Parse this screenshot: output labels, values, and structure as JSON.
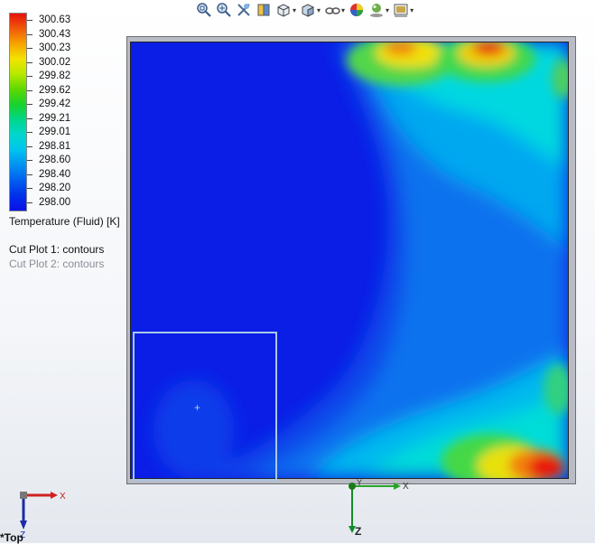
{
  "toolbar": {
    "items": [
      {
        "icon": "zoom-to-fit-icon",
        "caret": false
      },
      {
        "icon": "zoom-to-area-icon",
        "caret": false
      },
      {
        "icon": "previous-view-icon",
        "caret": false
      },
      {
        "icon": "section-view-icon",
        "caret": false
      },
      {
        "icon": "view-orientation-icon",
        "caret": true
      },
      {
        "icon": "display-style-icon",
        "caret": true
      },
      {
        "icon": "hide-show-items-icon",
        "caret": true
      },
      {
        "icon": "edit-appearance-icon",
        "caret": false
      },
      {
        "icon": "apply-scene-icon",
        "caret": true
      },
      {
        "icon": "view-settings-icon",
        "caret": true
      }
    ]
  },
  "legend": {
    "labels": [
      "300.63",
      "300.43",
      "300.23",
      "300.02",
      "299.82",
      "299.62",
      "299.42",
      "299.21",
      "299.01",
      "298.81",
      "298.60",
      "298.40",
      "298.20",
      "298.00"
    ],
    "colors": [
      "#e8100c",
      "#f05a08",
      "#f7a400",
      "#f2e400",
      "#b6e800",
      "#5cd800",
      "#18d22c",
      "#00d68a",
      "#00d6cc",
      "#00c4ee",
      "#0092f2",
      "#0060f0",
      "#0030ea",
      "#0a10e8"
    ],
    "title": "Temperature (Fluid) [K]"
  },
  "cut_plots": {
    "plot1": "Cut Plot 1: contours",
    "plot2": "Cut Plot 2: contours"
  },
  "triad": {
    "x_label": "X",
    "y_label": "Y",
    "z_label": "Z",
    "view_label": "*Top"
  }
}
